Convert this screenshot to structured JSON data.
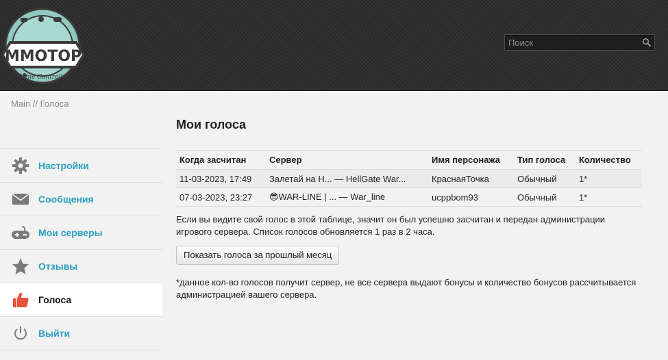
{
  "header": {
    "logo_text": "MMOTOP",
    "logo_subtitle": "Game Controller",
    "search": {
      "placeholder": "Поиск",
      "value": ""
    }
  },
  "breadcrumb": {
    "text": "Main // Голоса"
  },
  "sidebar": {
    "items": [
      {
        "label": "Настройки",
        "icon": "gear-icon",
        "active": false
      },
      {
        "label": "Сообщения",
        "icon": "envelope-icon",
        "active": false
      },
      {
        "label": "Мои серверы",
        "icon": "gamepad-icon",
        "active": false
      },
      {
        "label": "Отзывы",
        "icon": "star-icon",
        "active": false
      },
      {
        "label": "Голоса",
        "icon": "thumbs-up-icon",
        "active": true
      },
      {
        "label": "Выйти",
        "icon": "power-icon",
        "active": false
      }
    ]
  },
  "main": {
    "title": "Мои голоса",
    "table": {
      "headers": [
        "Когда засчитан",
        "Сервер",
        "Имя персонажа",
        "Тип голоса",
        "Количество"
      ],
      "rows": [
        [
          "11-03-2023, 17:49",
          "Залетай на Н... — HellGate War...",
          "КраснаяТочка",
          "Обычный",
          "1*"
        ],
        [
          "07-03-2023, 23:27",
          "😎WAR-LINE | ... — War_line",
          "ucppbom93",
          "Обычный",
          "1*"
        ]
      ]
    },
    "note": "Если вы видите свой голос в этой таблице, значит он был успешно засчитан и передан администрации игрового сервера. Список голосов обновляется 1 раз в 2 часа.",
    "button_label": "Показать голоса за прошлый месяц",
    "footnote": "*данное кол-во голосов получит сервер, не все сервера выдают бонусы и количество бонусов рассчитывается администрацией вашего сервера."
  },
  "colors": {
    "header_bg": "#2e2e2e",
    "link": "#2a9fc4",
    "active_icon": "#e8533a",
    "logo_teal": "#8fc9c1"
  }
}
